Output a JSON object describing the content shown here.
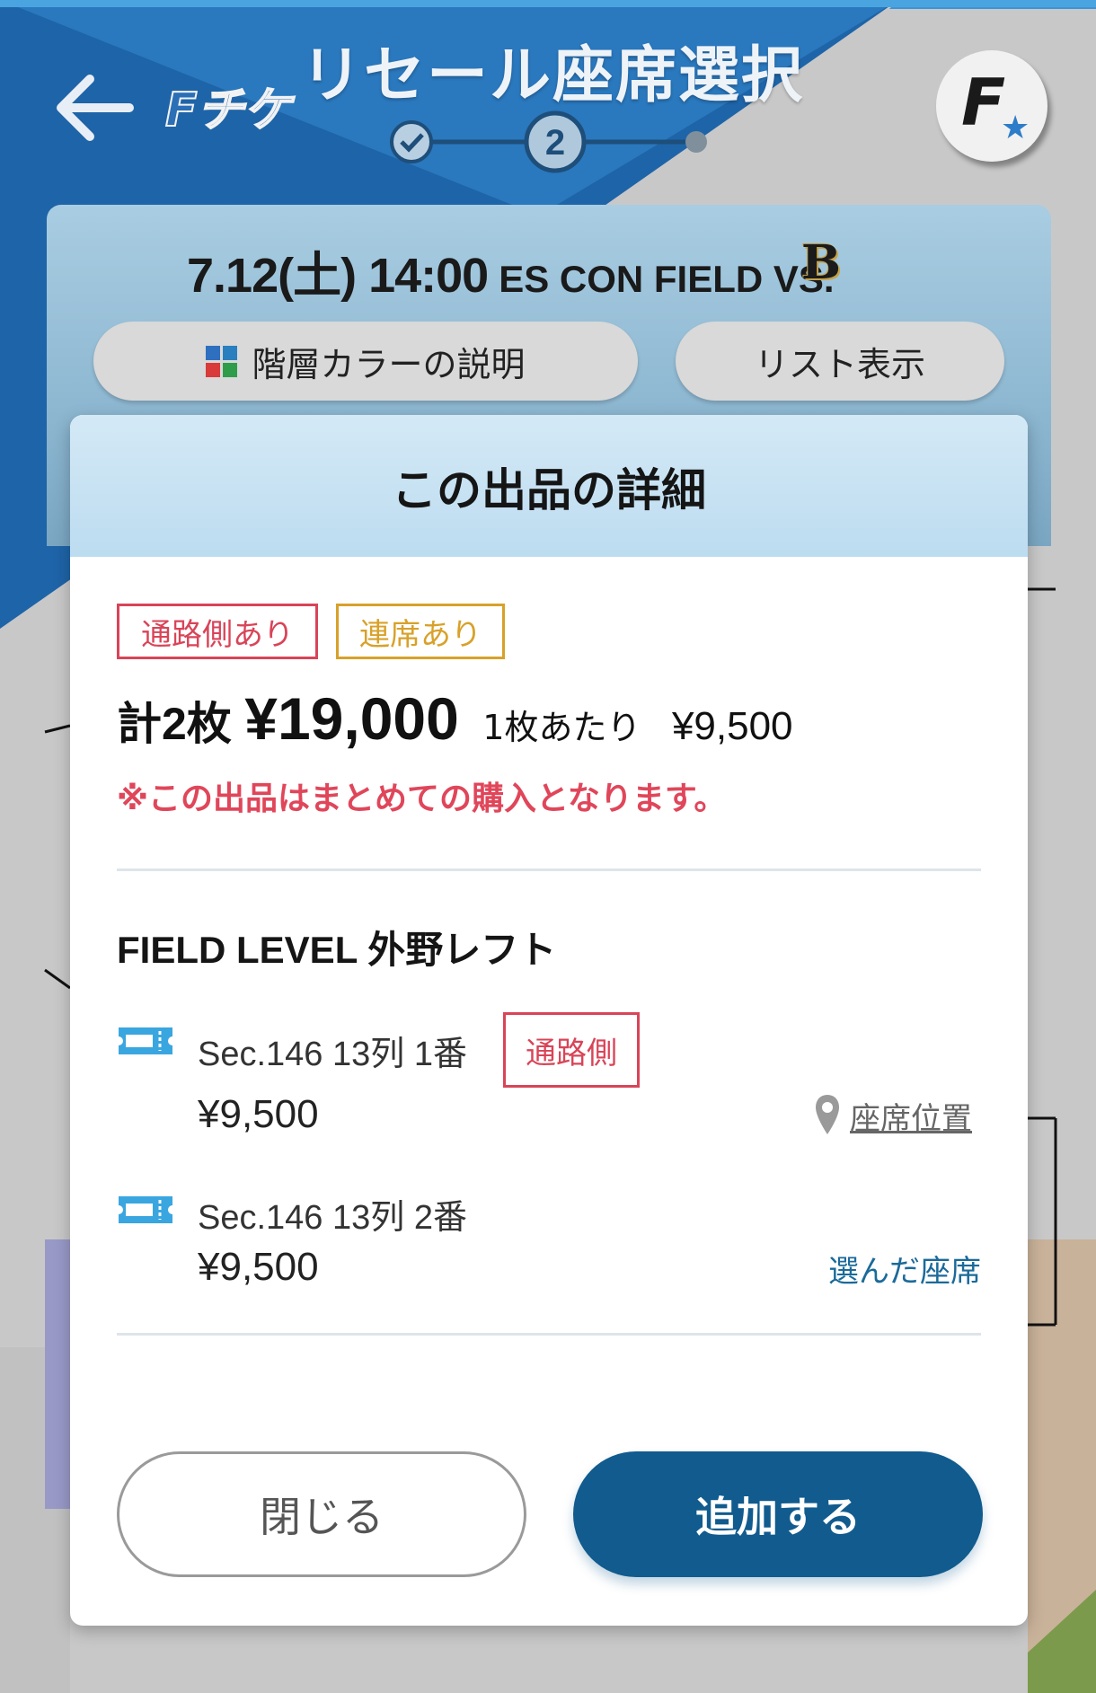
{
  "header": {
    "title": "リセール座席選択",
    "logo_text": "Fチケ",
    "stepper": {
      "completed_step": "✓",
      "current_step": "2"
    },
    "avatar_label": "F"
  },
  "event": {
    "date_time": "7.12(土) 14:00",
    "venue": "ES CON FIELD VS.",
    "opponent_logo_text": "B",
    "color_legend_button": "階層カラーの説明",
    "list_view_button": "リスト表示"
  },
  "modal": {
    "title": "この出品の詳細",
    "badges": {
      "aisle": "通路側あり",
      "adjacent": "連席あり"
    },
    "count": "計2枚",
    "total_price": "¥19,000",
    "per_label": "1枚あたり",
    "per_price": "¥9,500",
    "notice": "※この出品はまとめての購入となります。",
    "level": "FIELD LEVEL 外野レフト",
    "seats": [
      {
        "label": "Sec.146 13列 1番",
        "tag": "通路側",
        "price": "¥9,500",
        "link": "座席位置"
      },
      {
        "label": "Sec.146 13列 2番",
        "price": "¥9,500",
        "note": "選んだ座席"
      }
    ],
    "close_button": "閉じる",
    "add_button": "追加する"
  },
  "colors": {
    "primary": "#115b8e",
    "alert": "#e0465a",
    "aisle": "#d94458",
    "adjacent": "#d8a12a",
    "ticket_icon": "#3aa6e0"
  },
  "icons": [
    "back-arrow-icon",
    "check-icon",
    "color-grid-icon",
    "ticket-icon",
    "map-pin-icon",
    "star-icon"
  ]
}
